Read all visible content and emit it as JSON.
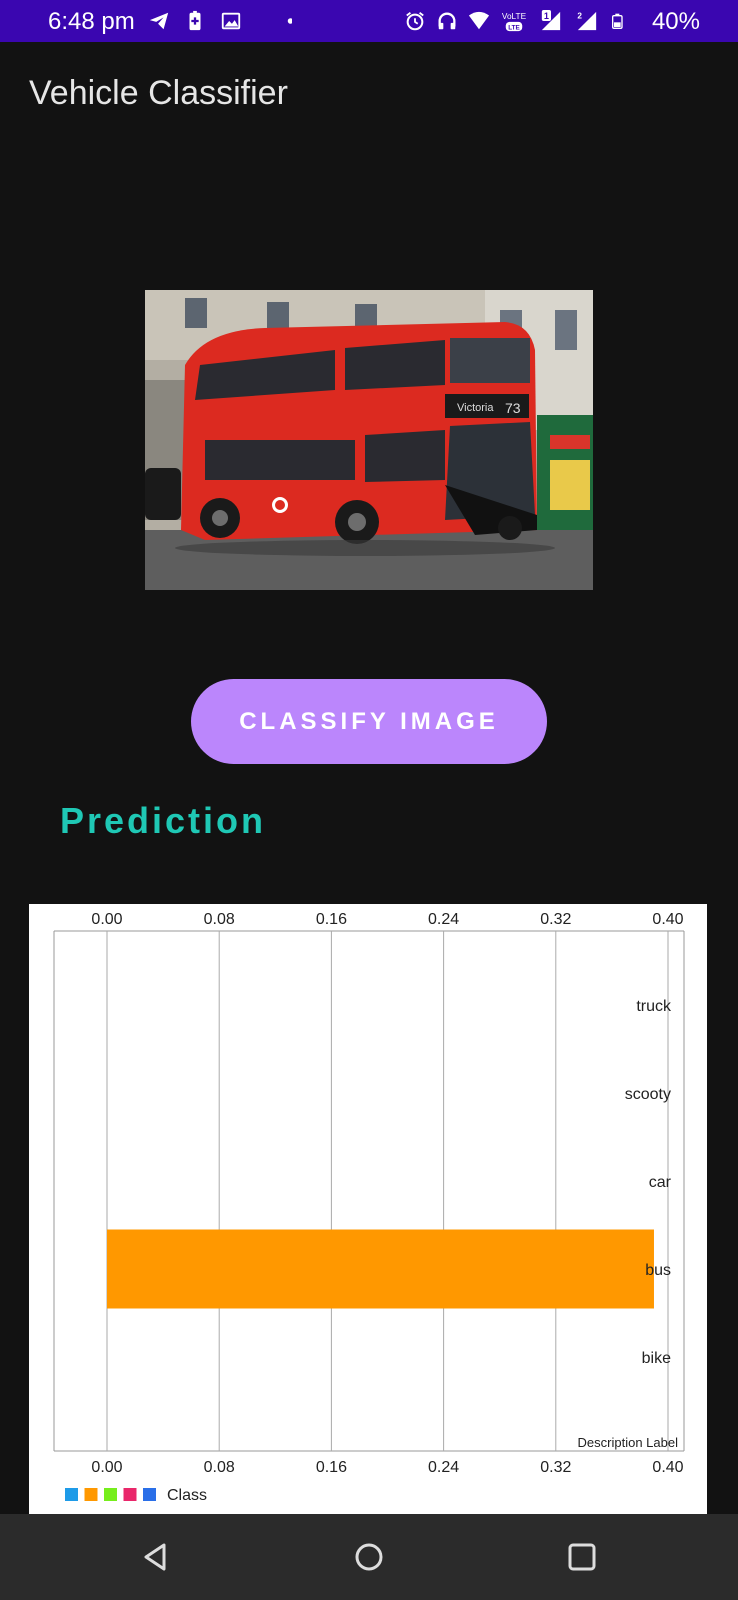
{
  "status_bar": {
    "time": "6:48 pm",
    "battery_percent": "40%",
    "lte_label": "LTE",
    "volte_label": "VoLTE",
    "sim1_label": "1",
    "sim2_label": "2",
    "icons_left": [
      "telegram-icon",
      "battery-saver-icon",
      "gallery-icon",
      "notification-dot-icon"
    ],
    "icons_right": [
      "alarm-icon",
      "headphones-icon",
      "wifi-icon",
      "volte-icon",
      "signal-sim1-icon",
      "signal-sim2-icon",
      "battery-icon"
    ]
  },
  "app": {
    "title": "Vehicle Classifier",
    "classify_button_label": "CLASSIFY IMAGE",
    "prediction_heading": "Prediction",
    "accent_color": "#bb86fc",
    "heading_color": "#1fc8b5"
  },
  "photo": {
    "subject": "red double-decker bus",
    "destination_sign": "Victoria",
    "route_number": "73"
  },
  "chart_data": {
    "type": "bar",
    "orientation": "horizontal",
    "categories": [
      "bike",
      "bus",
      "car",
      "scooty",
      "truck"
    ],
    "values": [
      0,
      0.39,
      0,
      0,
      0
    ],
    "bar_color": "#ff9800",
    "xlim": [
      0,
      0.4
    ],
    "x_ticks": [
      "0.00",
      "0.08",
      "0.16",
      "0.24",
      "0.32",
      "0.40"
    ],
    "description_label": "Description Label",
    "grid": true,
    "legend": {
      "placement": "bottom-left",
      "label": "Class",
      "colors": [
        "#1e9be8",
        "#ff9800",
        "#76ee1c",
        "#e9276a",
        "#2a6fe8"
      ]
    }
  },
  "nav_bar": {
    "buttons": [
      "back-icon",
      "home-icon",
      "recents-icon"
    ]
  }
}
